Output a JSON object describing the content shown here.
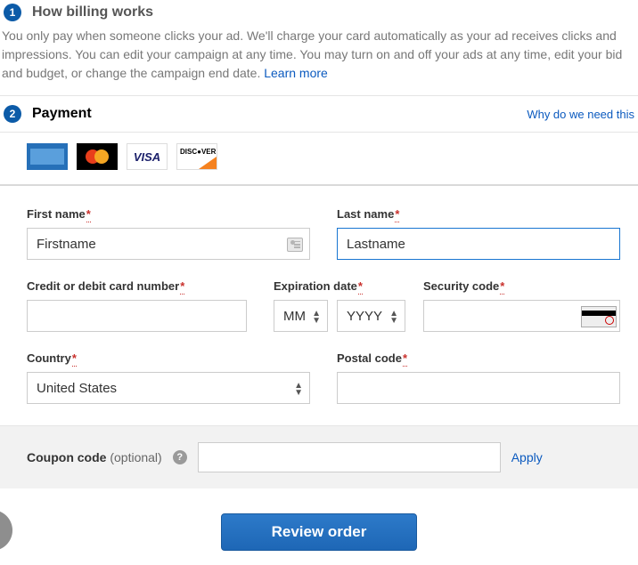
{
  "billing": {
    "step_num": "1",
    "title": "How billing works",
    "desc_part1": "You only pay when someone clicks your ad. We'll charge your card automatically as your ad receives clicks and impressions. You can edit your campaign at any time. You may turn on and off your ads at any time, edit your bid and budget, or change the campaign end date. ",
    "learn_more": "Learn more"
  },
  "payment": {
    "step_num": "2",
    "title": "Payment",
    "why_link": "Why do we need this",
    "card_brands": [
      "amex",
      "mastercard",
      "visa",
      "discover"
    ],
    "labels": {
      "first_name": "First name",
      "last_name": "Last name",
      "card_number": "Credit or debit card number",
      "exp_date": "Expiration date",
      "security_code": "Security code",
      "country": "Country",
      "postal_code": "Postal code"
    },
    "values": {
      "first_name": "Firstname",
      "last_name": "Lastname",
      "card_number": "",
      "exp_month_placeholder": "MM",
      "exp_year_placeholder": "YYYY",
      "security_code": "",
      "country": "United States",
      "postal_code": ""
    }
  },
  "coupon": {
    "label": "Coupon code",
    "optional": "(optional)",
    "help": "?",
    "value": "",
    "apply": "Apply"
  },
  "review_button": "Review order"
}
